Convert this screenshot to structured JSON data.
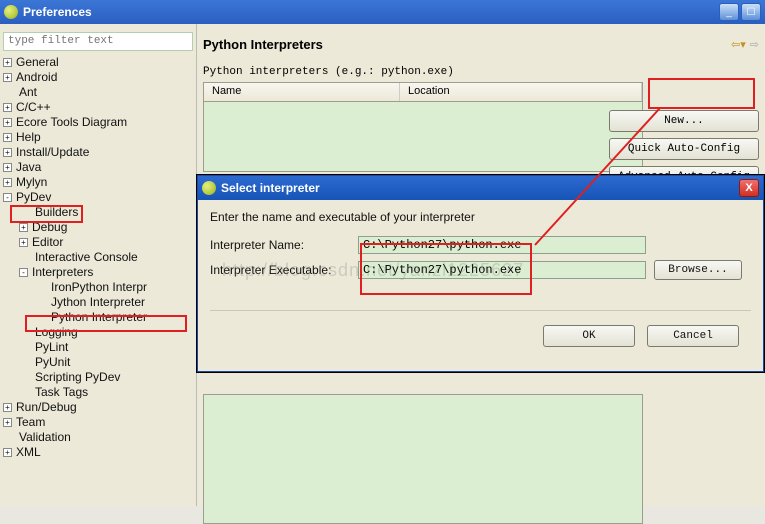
{
  "window": {
    "title": "Preferences"
  },
  "sidebar": {
    "filter_placeholder": "type filter text",
    "items": [
      {
        "exp": "+",
        "label": "General",
        "depth": 0
      },
      {
        "exp": "+",
        "label": "Android",
        "depth": 0
      },
      {
        "exp": "",
        "label": "Ant",
        "depth": 0
      },
      {
        "exp": "+",
        "label": "C/C++",
        "depth": 0
      },
      {
        "exp": "+",
        "label": "Ecore Tools Diagram",
        "depth": 0
      },
      {
        "exp": "+",
        "label": "Help",
        "depth": 0
      },
      {
        "exp": "+",
        "label": "Install/Update",
        "depth": 0
      },
      {
        "exp": "+",
        "label": "Java",
        "depth": 0
      },
      {
        "exp": "+",
        "label": "Mylyn",
        "depth": 0
      },
      {
        "exp": "-",
        "label": "PyDev",
        "depth": 0
      },
      {
        "exp": "",
        "label": "Builders",
        "depth": 1
      },
      {
        "exp": "+",
        "label": "Debug",
        "depth": 1
      },
      {
        "exp": "+",
        "label": "Editor",
        "depth": 1
      },
      {
        "exp": "",
        "label": "Interactive Console",
        "depth": 1
      },
      {
        "exp": "-",
        "label": "Interpreters",
        "depth": 1
      },
      {
        "exp": "",
        "label": "IronPython Interpr",
        "depth": 2
      },
      {
        "exp": "",
        "label": "Jython Interpreter",
        "depth": 2
      },
      {
        "exp": "",
        "label": "Python Interpreter",
        "depth": 2
      },
      {
        "exp": "",
        "label": "Logging",
        "depth": 1
      },
      {
        "exp": "",
        "label": "PyLint",
        "depth": 1
      },
      {
        "exp": "",
        "label": "PyUnit",
        "depth": 1
      },
      {
        "exp": "",
        "label": "Scripting PyDev",
        "depth": 1
      },
      {
        "exp": "",
        "label": "Task Tags",
        "depth": 1
      },
      {
        "exp": "+",
        "label": "Run/Debug",
        "depth": 0
      },
      {
        "exp": "+",
        "label": "Team",
        "depth": 0
      },
      {
        "exp": "",
        "label": "Validation",
        "depth": 0
      },
      {
        "exp": "+",
        "label": "XML",
        "depth": 0
      }
    ]
  },
  "page": {
    "heading": "Python Interpreters",
    "description": "Python interpreters (e.g.: python.exe)",
    "columns": {
      "name": "Name",
      "location": "Location"
    },
    "buttons": {
      "new": "New...",
      "quick": "Quick Auto-Config",
      "advanced": "Advanced Auto-Config"
    }
  },
  "modal": {
    "title": "Select interpreter",
    "prompt": "Enter the name and executable of your interpreter",
    "name_label": "Interpreter Name:",
    "name_value": "C:\\Python27\\python.exe",
    "exec_label": "Interpreter Executable:",
    "exec_value": "C:\\Python27\\python.exe",
    "browse": "Browse...",
    "ok": "OK",
    "cancel": "Cancel"
  },
  "watermark": "http://blog.csdn.net/yanzi1225627"
}
